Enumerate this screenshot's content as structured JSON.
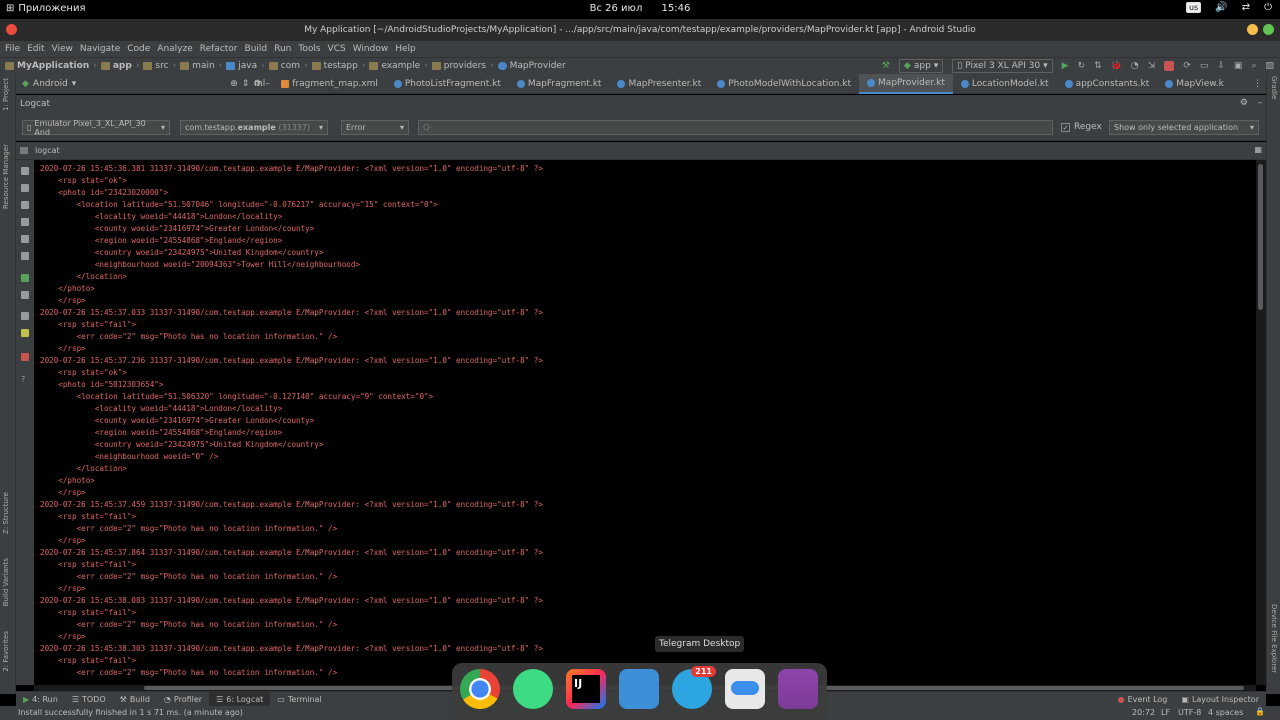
{
  "system_bar": {
    "activities_label": "Приложения",
    "date": "Вс 26 июл",
    "time": "15:46",
    "keyboard_layout": "us"
  },
  "window": {
    "title": "My Application [~/AndroidStudioProjects/MyApplication] - .../app/src/main/java/com/testapp/example/providers/MapProvider.kt [app] - Android Studio"
  },
  "menu": [
    "File",
    "Edit",
    "View",
    "Navigate",
    "Code",
    "Analyze",
    "Refactor",
    "Build",
    "Run",
    "Tools",
    "VCS",
    "Window",
    "Help"
  ],
  "breadcrumbs": [
    "MyApplication",
    "app",
    "src",
    "main",
    "java",
    "com",
    "testapp",
    "example",
    "providers",
    "MapProvider"
  ],
  "toolbar": {
    "run_config": "app",
    "device": "Pixel 3 XL API 30"
  },
  "project_view": {
    "selector": "Android"
  },
  "editor_tabs": [
    {
      "label": "ml",
      "color": "#cc7832"
    },
    {
      "label": "fragment_map.xml",
      "color": "#e08a3b"
    },
    {
      "label": "PhotoListFragment.kt",
      "color": "#4a88c7"
    },
    {
      "label": "MapFragment.kt",
      "color": "#4a88c7"
    },
    {
      "label": "MapPresenter.kt",
      "color": "#4a88c7"
    },
    {
      "label": "PhotoModelWithLocation.kt",
      "color": "#4a88c7"
    },
    {
      "label": "MapProvider.kt",
      "color": "#4a88c7",
      "active": true
    },
    {
      "label": "LocationModel.kt",
      "color": "#4a88c7"
    },
    {
      "label": "appConstants.kt",
      "color": "#4a88c7"
    },
    {
      "label": "MapView.k",
      "color": "#4a88c7"
    }
  ],
  "logcat": {
    "panel_title": "Logcat",
    "device_selector": "Emulator Pixel_3_XL_API_30 And",
    "process_prefix": "com.testapp.",
    "process_bold": "example",
    "process_pid": "(31337)",
    "level": "Error",
    "search_placeholder": "Q-",
    "regex_label": "Regex",
    "scope": "Show only selected application",
    "tab_label": "logcat",
    "lines": [
      "2020-07-26 15:45:36.381 31337-31490/com.testapp.example E/MapProvider: <?xml version=\"1.0\" encoding=\"utf-8\" ?>",
      "    <rsp stat=\"ok\">",
      "    <photo id=\"23423020000\">",
      "        <location latitude=\"51.507046\" longitude=\"-0.076217\" accuracy=\"15\" context=\"0\">",
      "            <locality woeid=\"44418\">London</locality>",
      "            <county woeid=\"23416974\">Greater London</county>",
      "            <region woeid=\"24554868\">England</region>",
      "            <country woeid=\"23424975\">United Kingdom</country>",
      "            <neighbourhood woeid=\"20094363\">Tower Hill</neighbourhood>",
      "        </location>",
      "    </photo>",
      "    </rsp>",
      "2020-07-26 15:45:37.033 31337-31490/com.testapp.example E/MapProvider: <?xml version=\"1.0\" encoding=\"utf-8\" ?>",
      "    <rsp stat=\"fail\">",
      "        <err code=\"2\" msg=\"Photo has no location information.\" />",
      "    </rsp>",
      "2020-07-26 15:45:37.236 31337-31490/com.testapp.example E/MapProvider: <?xml version=\"1.0\" encoding=\"utf-8\" ?>",
      "    <rsp stat=\"ok\">",
      "    <photo id=\"5012303654\">",
      "        <location latitude=\"51.506320\" longitude=\"-0.127140\" accuracy=\"9\" context=\"0\">",
      "            <locality woeid=\"44418\">London</locality>",
      "            <county woeid=\"23416974\">Greater London</county>",
      "            <region woeid=\"24554868\">England</region>",
      "            <country woeid=\"23424975\">United Kingdom</country>",
      "            <neighbourhood woeid=\"0\" />",
      "        </location>",
      "    </photo>",
      "    </rsp>",
      "2020-07-26 15:45:37.459 31337-31490/com.testapp.example E/MapProvider: <?xml version=\"1.0\" encoding=\"utf-8\" ?>",
      "    <rsp stat=\"fail\">",
      "        <err code=\"2\" msg=\"Photo has no location information.\" />",
      "    </rsp>",
      "2020-07-26 15:45:37.864 31337-31490/com.testapp.example E/MapProvider: <?xml version=\"1.0\" encoding=\"utf-8\" ?>",
      "    <rsp stat=\"fail\">",
      "        <err code=\"2\" msg=\"Photo has no location information.\" />",
      "    </rsp>",
      "2020-07-26 15:45:38.083 31337-31490/com.testapp.example E/MapProvider: <?xml version=\"1.0\" encoding=\"utf-8\" ?>",
      "    <rsp stat=\"fail\">",
      "        <err code=\"2\" msg=\"Photo has no location information.\" />",
      "    </rsp>",
      "2020-07-26 15:45:38.303 31337-31490/com.testapp.example E/MapProvider: <?xml version=\"1.0\" encoding=\"utf-8\" ?>",
      "    <rsp stat=\"fail\">",
      "        <err code=\"2\" msg=\"Photo has no location information.\" />"
    ]
  },
  "left_stripe": {
    "project": "1: Project",
    "resource_manager": "Resource Manager",
    "structure": "Z: Structure",
    "build_variants": "Build Variants",
    "favorites": "2: Favorites"
  },
  "right_stripe": {
    "gradle": "Gradle",
    "device_file_explorer": "Device File Explorer"
  },
  "bottom_tools": [
    {
      "label": "4: Run",
      "icon": "run-icon"
    },
    {
      "label": "TODO",
      "icon": "todo-icon"
    },
    {
      "label": "Build",
      "icon": "build-icon"
    },
    {
      "label": "Profiler",
      "icon": "profiler-icon"
    },
    {
      "label": "6: Logcat",
      "icon": "logcat-icon",
      "active": true
    },
    {
      "label": "Terminal",
      "icon": "terminal-icon"
    }
  ],
  "bottom_right_tools": {
    "event_log": "Event Log",
    "layout_inspector": "Layout Inspector"
  },
  "status": {
    "message": "Install successfully finished in 1 s 71 ms. (a minute ago)",
    "position": "20:72",
    "line_separator": "LF",
    "encoding": "UTF-8",
    "indent": "4 spaces"
  },
  "dock": {
    "tooltip": "Telegram Desktop",
    "telegram_badge": "211",
    "apps": [
      "chrome-icon",
      "android-studio-icon",
      "intellij-idea-eap-icon",
      "workspaces-icon",
      "telegram-icon",
      "settings-toggle-icon",
      "app-store-icon"
    ]
  },
  "colors": {
    "log_error": "#e06666",
    "ide_bg": "#3c3f41",
    "accent": "#4a88c7"
  }
}
